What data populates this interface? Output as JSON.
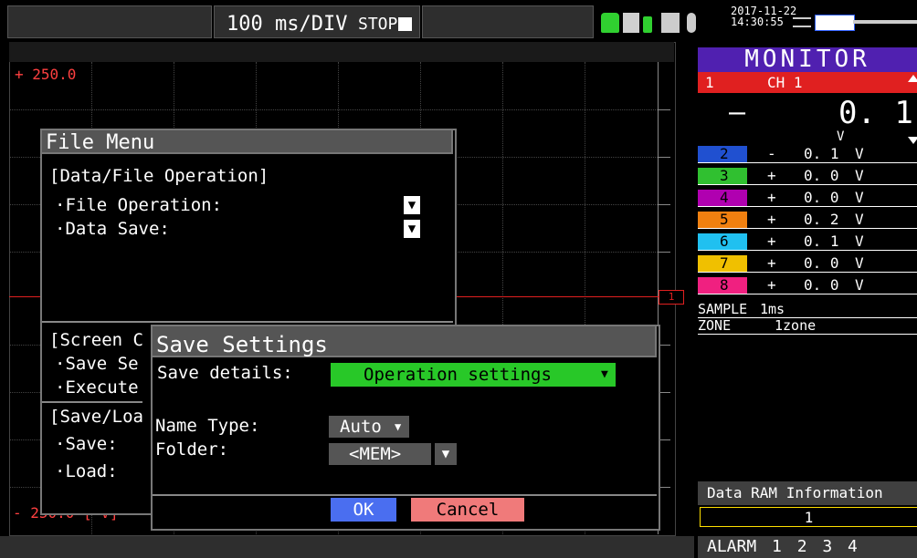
{
  "header": {
    "timebase": "100 ms/DIV",
    "status": "STOP",
    "date": "2017-11-22",
    "time": "14:30:55"
  },
  "graph": {
    "upper_limit": "+ 250.0",
    "lower_limit": "- 250.0 [ V]",
    "channel_marker": "1"
  },
  "monitor": {
    "title": "MONITOR",
    "ch1": {
      "num": "1",
      "name": "CH 1",
      "sign": "—",
      "value": "0. 1",
      "unit": "V"
    },
    "channels": [
      {
        "num": "2",
        "sign": "-",
        "value": "0. 1",
        "unit": "V",
        "color": "#2050d0"
      },
      {
        "num": "3",
        "sign": "+",
        "value": "0. 0",
        "unit": "V",
        "color": "#30c030"
      },
      {
        "num": "4",
        "sign": "+",
        "value": "0. 0",
        "unit": "V",
        "color": "#b000b0"
      },
      {
        "num": "5",
        "sign": "+",
        "value": "0. 2",
        "unit": "V",
        "color": "#f08010"
      },
      {
        "num": "6",
        "sign": "+",
        "value": "0. 1",
        "unit": "V",
        "color": "#20c0f0"
      },
      {
        "num": "7",
        "sign": "+",
        "value": "0. 0",
        "unit": "V",
        "color": "#f0c000"
      },
      {
        "num": "8",
        "sign": "+",
        "value": "0. 0",
        "unit": "V",
        "color": "#f02080"
      }
    ],
    "sample_label": "SAMPLE",
    "sample_value": "1ms",
    "zone_label": "ZONE",
    "zone_value": "1zone",
    "ram_title": "Data RAM Information",
    "ram_value": "1",
    "alarm_text": "ALARM 1 2 3 4"
  },
  "file_menu": {
    "title": "File Menu",
    "section1": "[Data/File Operation]",
    "file_operation": "·File Operation:",
    "data_save": "·Data Save:",
    "section2": "[Screen C",
    "save_se": "·Save Se",
    "execute": "·Execute",
    "section3": "[Save/Loa",
    "save": "·Save:",
    "load": "·Load:"
  },
  "save_settings": {
    "title": "Save Settings",
    "details_label": "Save details:",
    "details_value": "Operation settings",
    "name_type_label": "Name Type:",
    "name_type_value": "Auto",
    "folder_label": "Folder:",
    "folder_value": "<MEM>",
    "ok_label": "OK",
    "cancel_label": "Cancel"
  }
}
